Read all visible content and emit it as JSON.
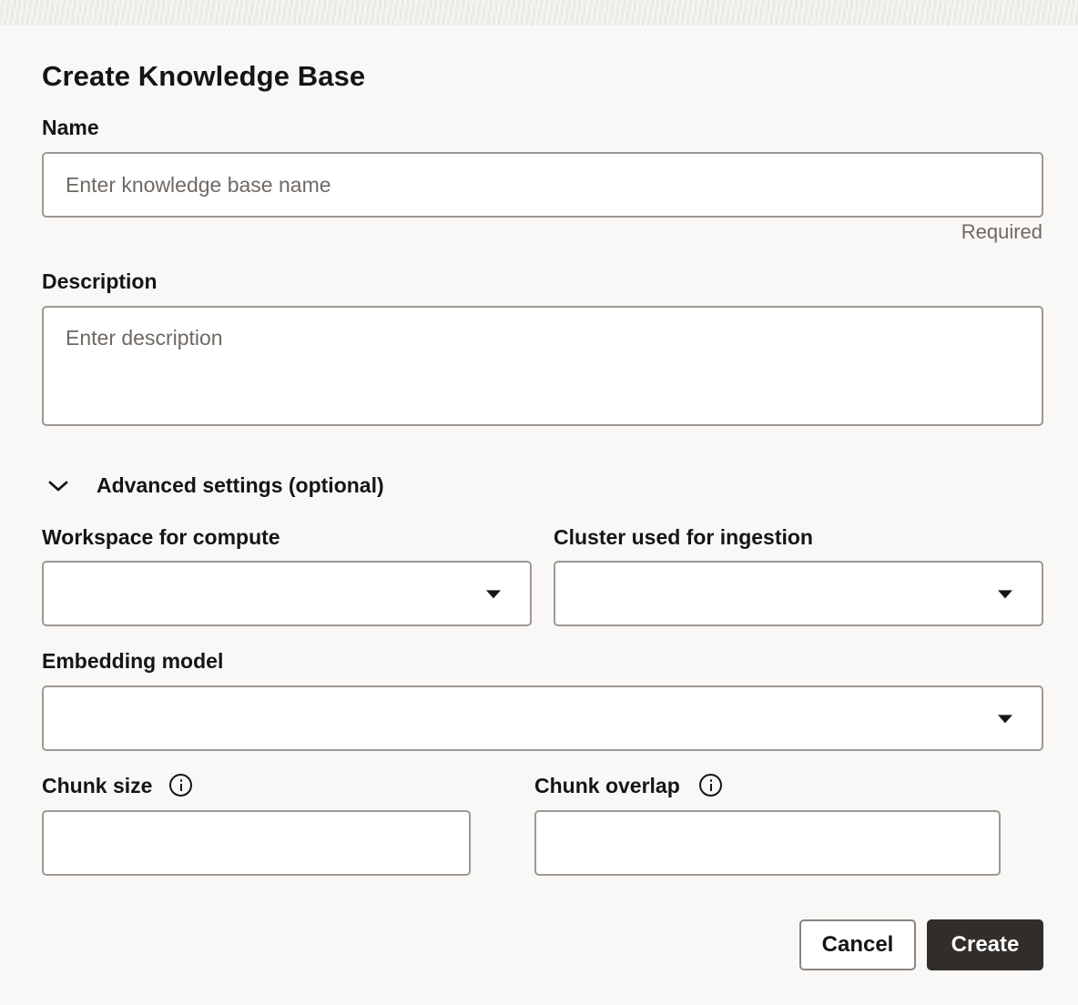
{
  "dialog": {
    "title": "Create Knowledge Base"
  },
  "name_field": {
    "label": "Name",
    "placeholder": "Enter knowledge base name",
    "value": "",
    "helper": "Required"
  },
  "description_field": {
    "label": "Description",
    "placeholder": "Enter description",
    "value": ""
  },
  "advanced": {
    "toggle_label": "Advanced settings (optional)",
    "expanded": true,
    "toggle_icon": "chevron-down-icon",
    "workspace": {
      "label": "Workspace for compute",
      "value": ""
    },
    "cluster": {
      "label": "Cluster used for ingestion",
      "value": ""
    },
    "embedding_model": {
      "label": "Embedding model",
      "value": ""
    },
    "chunk_size": {
      "label": "Chunk size",
      "value": "",
      "icon": "info-icon"
    },
    "chunk_overlap": {
      "label": "Chunk overlap",
      "value": "",
      "icon": "info-icon"
    }
  },
  "footer": {
    "cancel_label": "Cancel",
    "create_label": "Create"
  },
  "colors": {
    "background": "#f9f8f6",
    "border": "#9e9892",
    "primary_button": "#312d2a",
    "text": "#161513",
    "placeholder": "#6f6964"
  }
}
